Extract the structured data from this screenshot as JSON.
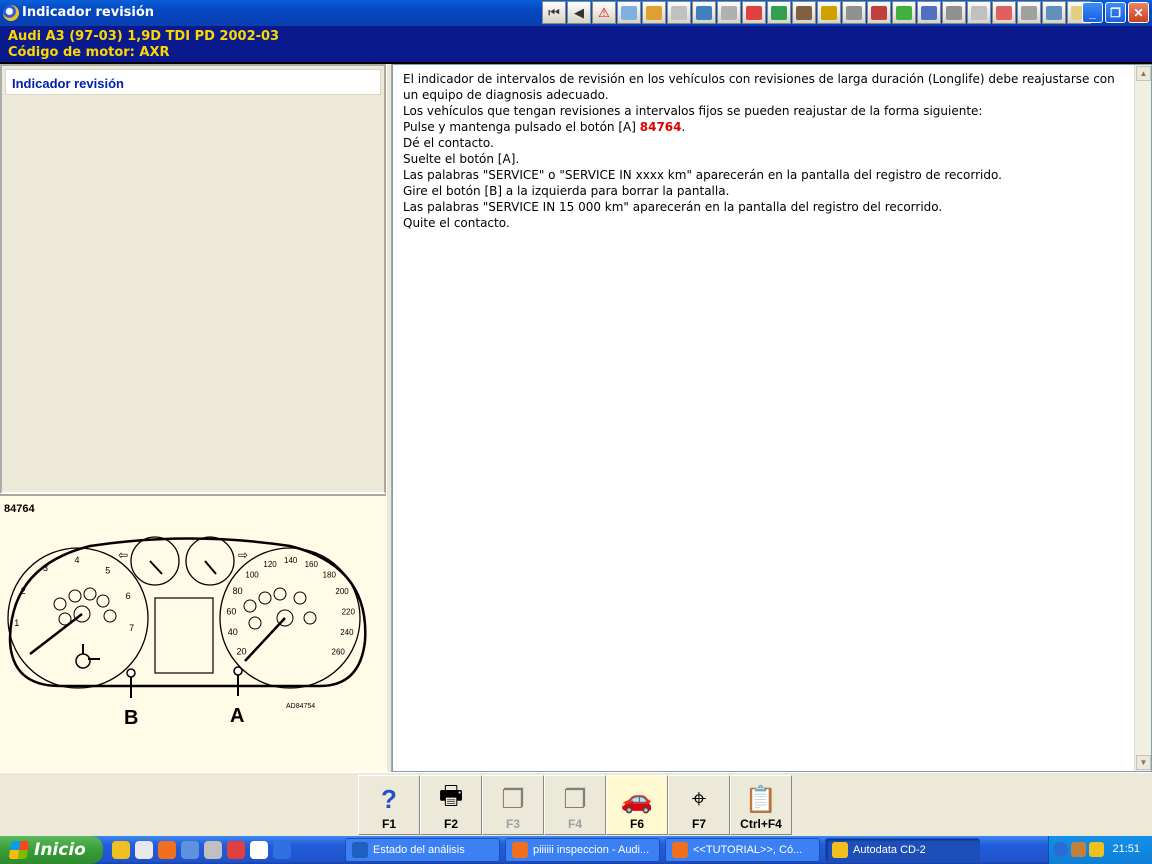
{
  "window": {
    "title": "Indicador revisión",
    "toolbar_icons": [
      "first-page-icon",
      "prev-page-icon",
      "warning-icon",
      "manual-icon",
      "engine-icon",
      "service-icon",
      "tire-icon",
      "tools-icon",
      "electric-icon",
      "battery-icon",
      "lift-icon",
      "oil-icon",
      "gearbox-icon",
      "brake-icon",
      "body-icon",
      "parts-icon",
      "cable-icon",
      "wrench-icon",
      "airbag-icon",
      "settings-icon",
      "transmission-icon",
      "note-icon"
    ],
    "toolbar_glyphs": [
      "⏮",
      "◀",
      "⚠",
      "",
      "",
      "",
      "",
      "",
      "",
      "",
      "",
      "",
      "",
      "",
      "",
      "",
      "",
      "",
      "",
      "",
      "",
      ""
    ],
    "toolbar_colors": [
      "#ffffff",
      "#ffffff",
      "#ffd000",
      "#7fb0e0",
      "#e0a030",
      "#c0c0c0",
      "#4080c0",
      "#b0b0b0",
      "#e04040",
      "#30a050",
      "#806040",
      "#d0a000",
      "#909090",
      "#c04040",
      "#40b040",
      "#5070c0",
      "#909090",
      "#c0c0c0",
      "#e06060",
      "#a0a0a0",
      "#6090c0",
      "#e0d080"
    ],
    "minimize": "_",
    "maximize": "❐",
    "close": "✕"
  },
  "vehicle": {
    "model_line": "Audi   A3 (97-03) 1,9D TDI PD 2002-03",
    "engine_line": "Código de motor: AXR"
  },
  "sidebar": {
    "items": [
      {
        "label": "Indicador revisión"
      }
    ]
  },
  "illustration": {
    "figure_code": "84764",
    "label_b": "B",
    "label_a": "A",
    "image_code": "AD84754",
    "speed_ticks": [
      "20",
      "40",
      "60",
      "80",
      "100",
      "120",
      "140",
      "160",
      "180",
      "200",
      "220",
      "240",
      "260"
    ],
    "rpm_ticks": [
      "1",
      "2",
      "3",
      "4",
      "5",
      "6",
      "7"
    ]
  },
  "content": {
    "line1": "El indicador de intervalos de revisión en los vehículos con revisiones de larga duración (Longlife) debe reajustarse con un equipo de diagnosis adecuado.",
    "line2": "Los vehículos que tengan revisiones a intervalos fijos se pueden reajustar de la forma siguiente:",
    "line3_prefix": "Pulse y mantenga pulsado el botón [A]",
    "line3_ref": "84764",
    "line3_suffix": ".",
    "line4": "Dé el contacto.",
    "line5": "Suelte el botón [A].",
    "line6": "Las palabras \"SERVICE\" o \"SERVICE IN xxxx km\" aparecerán en la pantalla del registro de recorrido.",
    "line7": "Gire el botón [B] a la izquierda para borrar la pantalla.",
    "line8": "Las palabras \"SERVICE IN 15 000 km\" aparecerán en la pantalla del registro del recorrido.",
    "line9": "Quite el contacto."
  },
  "function_keys": [
    {
      "label": "F1",
      "icon": "help-icon",
      "glyph": "?",
      "enabled": true
    },
    {
      "label": "F2",
      "icon": "printer-icon",
      "glyph": "🖶",
      "enabled": true
    },
    {
      "label": "F3",
      "icon": "copy-pages-icon",
      "glyph": "❐",
      "enabled": false
    },
    {
      "label": "F4",
      "icon": "paste-pages-icon",
      "glyph": "❐",
      "enabled": false
    },
    {
      "label": "F6",
      "icon": "car-service-icon",
      "glyph": "🚗",
      "enabled": true
    },
    {
      "label": "F7",
      "icon": "zoom-target-icon",
      "glyph": "⌖",
      "enabled": true
    },
    {
      "label": "Ctrl+F4",
      "icon": "notes-icon",
      "glyph": "📋",
      "enabled": true
    }
  ],
  "taskbar": {
    "start_label": "Inicio",
    "quick_launch_colors": [
      "#f0c020",
      "#e8e8e8",
      "#f07020",
      "#6090e0",
      "#c0c0c0",
      "#e04040",
      "#ffffff",
      "#3070e0"
    ],
    "tasks": [
      {
        "label": "Estado del análisis",
        "icon": "z-icon",
        "color": "#2060c0",
        "active": false
      },
      {
        "label": "piiiiii inspeccion - Audi...",
        "icon": "firefox-icon",
        "color": "#f07020",
        "active": false
      },
      {
        "label": "<<TUTORIAL>>, Có...",
        "icon": "firefox-icon",
        "color": "#f07020",
        "active": false
      },
      {
        "label": "Autodata CD-2",
        "icon": "autodata-icon",
        "color": "#f0c020",
        "active": true
      }
    ],
    "clock": "21:51"
  }
}
